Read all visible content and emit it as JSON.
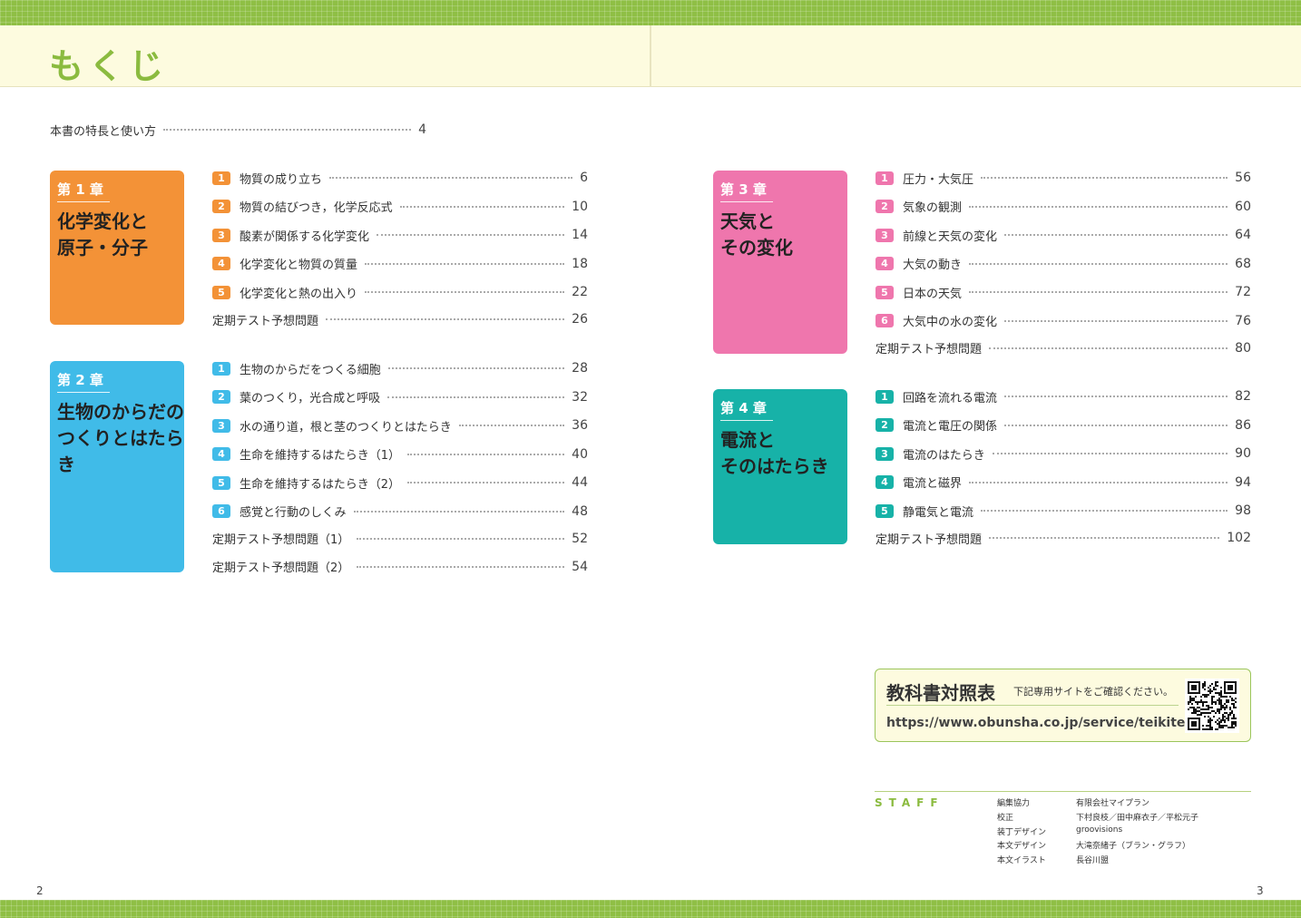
{
  "header": {
    "title": "もくじ"
  },
  "intro": {
    "label": "本書の特長と使い方",
    "page": "4"
  },
  "colors": {
    "green": "#8bbb3f",
    "chapter1": "#f39237",
    "chapter2": "#40bbe8",
    "chapter3": "#ef76ad",
    "chapter4": "#17b2a8"
  },
  "chapters": [
    {
      "number": "第 1 章",
      "title": "化学変化と\n原子・分子",
      "entries": [
        {
          "badge": "1",
          "label": "物質の成り立ち",
          "page": "6"
        },
        {
          "badge": "2",
          "label": "物質の結びつき，化学反応式",
          "page": "10"
        },
        {
          "badge": "3",
          "label": "酸素が関係する化学変化",
          "page": "14"
        },
        {
          "badge": "4",
          "label": "化学変化と物質の質量",
          "page": "18"
        },
        {
          "badge": "5",
          "label": "化学変化と熱の出入り",
          "page": "22"
        },
        {
          "badge": "",
          "label": "定期テスト予想問題",
          "page": "26"
        }
      ]
    },
    {
      "number": "第 2 章",
      "title": "生物のからだの\nつくりとはたらき",
      "entries": [
        {
          "badge": "1",
          "label": "生物のからだをつくる細胞",
          "page": "28"
        },
        {
          "badge": "2",
          "label": "葉のつくり，光合成と呼吸",
          "page": "32"
        },
        {
          "badge": "3",
          "label": "水の通り道，根と茎のつくりとはたらき",
          "page": "36"
        },
        {
          "badge": "4",
          "label": "生命を維持するはたらき（1）",
          "page": "40"
        },
        {
          "badge": "5",
          "label": "生命を維持するはたらき（2）",
          "page": "44"
        },
        {
          "badge": "6",
          "label": "感覚と行動のしくみ",
          "page": "48"
        },
        {
          "badge": "",
          "label": "定期テスト予想問題（1）",
          "page": "52"
        },
        {
          "badge": "",
          "label": "定期テスト予想問題（2）",
          "page": "54"
        }
      ]
    },
    {
      "number": "第 3 章",
      "title": "天気と\nその変化",
      "entries": [
        {
          "badge": "1",
          "label": "圧力・大気圧",
          "page": "56"
        },
        {
          "badge": "2",
          "label": "気象の観測",
          "page": "60"
        },
        {
          "badge": "3",
          "label": "前線と天気の変化",
          "page": "64"
        },
        {
          "badge": "4",
          "label": "大気の動き",
          "page": "68"
        },
        {
          "badge": "5",
          "label": "日本の天気",
          "page": "72"
        },
        {
          "badge": "6",
          "label": "大気中の水の変化",
          "page": "76"
        },
        {
          "badge": "",
          "label": "定期テスト予想問題",
          "page": "80"
        }
      ]
    },
    {
      "number": "第 4 章",
      "title": "電流と\nそのはたらき",
      "entries": [
        {
          "badge": "1",
          "label": "回路を流れる電流",
          "page": "82"
        },
        {
          "badge": "2",
          "label": "電流と電圧の関係",
          "page": "86"
        },
        {
          "badge": "3",
          "label": "電流のはたらき",
          "page": "90"
        },
        {
          "badge": "4",
          "label": "電流と磁界",
          "page": "94"
        },
        {
          "badge": "5",
          "label": "静電気と電流",
          "page": "98"
        },
        {
          "badge": "",
          "label": "定期テスト予想問題",
          "page": "102"
        }
      ]
    }
  ],
  "textbook_table": {
    "title": "教科書対照表",
    "note": "下記専用サイトをご確認ください。",
    "url": "https://www.obunsha.co.jp/service/teikitest/"
  },
  "staff": {
    "heading": "STAFF",
    "rows": [
      {
        "role": "編集協力",
        "name": "有限会社マイプラン"
      },
      {
        "role": "校正",
        "name": "下村良枝／田中麻衣子／平松元子"
      },
      {
        "role": "装丁デザイン",
        "name": "groovisions"
      },
      {
        "role": "本文デザイン",
        "name": "大滝奈緒子（ブラン・グラフ）"
      },
      {
        "role": "本文イラスト",
        "name": "長谷川盟"
      }
    ]
  },
  "page_numbers": {
    "left": "2",
    "right": "3"
  }
}
